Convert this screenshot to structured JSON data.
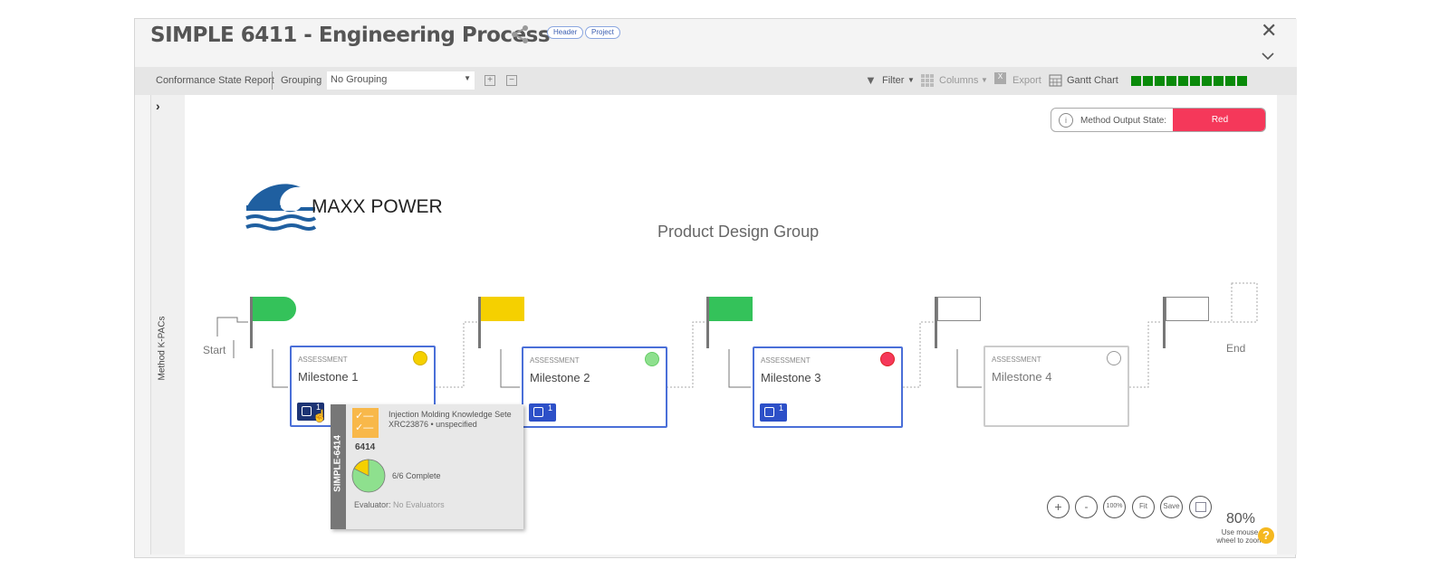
{
  "header": {
    "title": "SIMPLE 6411 - Engineering Process",
    "tags": [
      "Header",
      "Project"
    ]
  },
  "toolbar": {
    "report": "Conformance State Report",
    "grouping_label": "Grouping",
    "grouping_value": "No Grouping",
    "filter": "Filter",
    "columns": "Columns",
    "export": "Export",
    "gantt": "Gantt Chart",
    "progress_segments": 10,
    "progress_filled": 10,
    "progress_color": "#0a8a0a"
  },
  "sidebar": {
    "label": "Method K-PACs"
  },
  "state": {
    "label": "Method Output State:",
    "value": "Red",
    "color": "#f5385a"
  },
  "logo": {
    "text": "MAXX POWER"
  },
  "diagram": {
    "group_title": "Product Design Group",
    "start": "Start",
    "end": "End",
    "flags": [
      "#34c25a",
      "#f5d000",
      "#34c25a",
      "none",
      "none"
    ],
    "milestones": [
      {
        "type": "ASSESSMENT",
        "name": "Milestone 1",
        "status": "#f5d000",
        "kpacs": "1"
      },
      {
        "type": "ASSESSMENT",
        "name": "Milestone 2",
        "status": "#8ee08e",
        "kpacs": "1"
      },
      {
        "type": "ASSESSMENT",
        "name": "Milestone 3",
        "status": "#f5385a",
        "kpacs": "1"
      },
      {
        "type": "ASSESSMENT",
        "name": "Milestone 4",
        "status": "none"
      }
    ]
  },
  "tooltip": {
    "side": "SIMPLE-6414",
    "title": "Injection Molding Knowledge Sete",
    "subtitle": "XRC23876 • unspecified",
    "id": "6414",
    "complete": "6/6 Complete",
    "evaluator_label": "Evaluator:",
    "evaluator_value": "No Evaluators"
  },
  "zoom": {
    "buttons": [
      "+",
      "-",
      "100%",
      "Fit",
      "Save"
    ],
    "level": "80%",
    "hint": "Use mouse wheel to zoom"
  }
}
